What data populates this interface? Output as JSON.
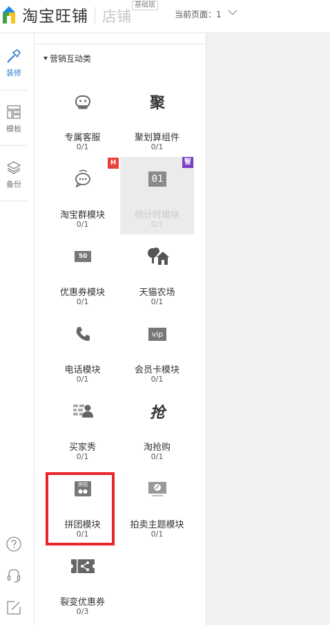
{
  "header": {
    "brand": "淘宝旺铺",
    "shop_label": "店铺",
    "edition_badge": "基础版",
    "page_indicator": "当前页面：1"
  },
  "rail": {
    "items": [
      {
        "label": "装修",
        "icon": "brush-icon",
        "active": true
      },
      {
        "label": "模板",
        "icon": "template-icon",
        "active": false
      },
      {
        "label": "备份",
        "icon": "layers-icon",
        "active": false
      }
    ],
    "bottom_icons": [
      "help-icon",
      "headset-icon",
      "edit-icon"
    ]
  },
  "panel": {
    "category": "营销互动类",
    "modules": [
      {
        "name": "专属客服",
        "count": "0/1",
        "icon": "service-bot-icon"
      },
      {
        "name": "聚划算组件",
        "count": "0/1",
        "icon": "juhuasuan-icon",
        "glyph": "聚"
      },
      {
        "name": "淘宝群模块",
        "count": "0/1",
        "icon": "group-chat-icon",
        "badge": "H"
      },
      {
        "name": "倒计时模块",
        "count": "0/1",
        "icon": "countdown-icon",
        "glyph": "01",
        "badge": "智",
        "disabled": true
      },
      {
        "name": "优惠券模块",
        "count": "0/1",
        "icon": "coupon-icon",
        "glyph": "50"
      },
      {
        "name": "天猫农场",
        "count": "0/1",
        "icon": "farm-icon"
      },
      {
        "name": "电话模块",
        "count": "0/1",
        "icon": "phone-icon"
      },
      {
        "name": "会员卡模块",
        "count": "0/1",
        "icon": "vip-card-icon",
        "glyph": "vip"
      },
      {
        "name": "买家秀",
        "count": "0/1",
        "icon": "buyer-show-icon"
      },
      {
        "name": "淘抢购",
        "count": "0/1",
        "icon": "flash-sale-icon",
        "glyph": "抢"
      },
      {
        "name": "拼团模块",
        "count": "0/1",
        "icon": "group-buy-icon",
        "glyph": "拼团",
        "highlighted": true
      },
      {
        "name": "拍卖主题模块",
        "count": "0/1",
        "icon": "auction-icon"
      },
      {
        "name": "裂变优惠券",
        "count": "0/3",
        "icon": "share-coupon-icon"
      }
    ]
  },
  "colors": {
    "accent_blue": "#2f7fd0",
    "highlight_red": "#e8262b",
    "badge_h": "#e8413a",
    "badge_smart": "#7a3fc4",
    "icon_gray": "#666666"
  }
}
